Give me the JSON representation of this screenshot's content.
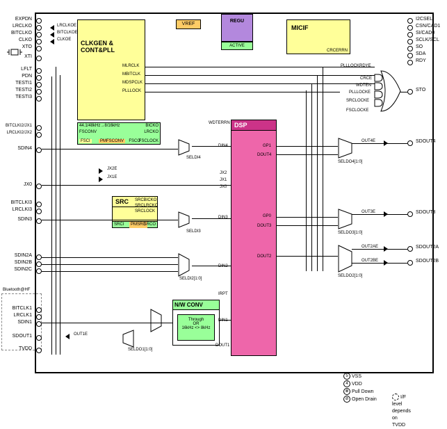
{
  "blocks": {
    "clkgen": "CLKGEN &\nCONT&PLL",
    "vref": "VREF",
    "regu_title": "REGU",
    "regu_sub": "ACTIVE",
    "micif": "MICIF",
    "micif_sub": "CRCERRN",
    "dsp": "DSP",
    "src": "SRC",
    "nwconv": "N/W  CONV",
    "nwconv_thru": "Through\nOR\n16kHz <> 8kHz"
  },
  "left_pins": [
    "EXPDN",
    "LRCLKO",
    "BITCLKO",
    "CLKO",
    "XTO",
    "XTI",
    "LFLT",
    "PDN",
    "TESTI1",
    "TESTI2",
    "TESTI3",
    "BITCLKI2/JX1",
    "LRCLKI2/JX2",
    "SDIN4",
    "",
    "",
    "JX0",
    "BITCLKI3",
    "LRCLKI3",
    "SDIN3",
    "",
    "SDIN2A",
    "SDIN2B",
    "SDIN2C",
    "",
    "Bluetooth@HF",
    "BITCLK1",
    "LRCLK1",
    "SDIN1",
    "SDOUT1",
    "TVDD"
  ],
  "right_pins_top": [
    "I2CSEL",
    "CSN/CAD1",
    "SI/CAD0",
    "SCLK/SCL",
    "SO",
    "SDA",
    "RDY"
  ],
  "right_pins_mid": [
    "STO"
  ],
  "right_pins_out": [
    "SDOUT4",
    "SDOUT3",
    "SDOUT2A",
    "SDOUT2B"
  ],
  "clk_right": [
    "MLRCLK",
    "MBITCLK",
    "MDSPCLK",
    "PLLLOCK"
  ],
  "clk_sub": [
    "44.1/48kHz→8/16kHz",
    "FSCONV",
    "FSCI",
    "PMFSCONV",
    "FSCO",
    "BICKO",
    "LRCKO",
    "FSCLOCK"
  ],
  "inner_right_top": [
    "PLLLOCKRDYE",
    "CRCE",
    "WDTEN",
    "PLLLOCKE",
    "SRCLOCKE",
    "FSCLOCKE"
  ],
  "dsp_left": [
    "WDTERRN",
    "DIN4",
    "SELDI4",
    "JX2",
    "JX1",
    "JX0",
    "DIN3",
    "SELDI3",
    "DIN2",
    "SELDI2[1:0]",
    "IRPT",
    "DIN1",
    "DOUT1"
  ],
  "dsp_right": [
    "GP1",
    "DOUT4",
    "",
    "",
    "GP0",
    "DOUT3",
    "",
    "DOUT2",
    "",
    ""
  ],
  "sel_labels": [
    "OUT4E",
    "SELDO4[1:0]",
    "OUT3E",
    "SELDO3[1:0]",
    "OUT2AE",
    "OUT2BE",
    "SELDO2[1:0]",
    "SELDO1[1:0]"
  ],
  "src_sub": [
    "SRCBICKO",
    "SRCLRCKO",
    "SRCLOCK",
    "SRCI",
    "PMSRC",
    "SRCO"
  ],
  "misc": {
    "jx2e": "JX2E",
    "jx1e": "JX1E",
    "out1e": "OUT1E"
  },
  "legend": [
    "VSS",
    "VDD",
    "Pull Down",
    "Open Drain",
    "I/F level depends on TVDD"
  ]
}
